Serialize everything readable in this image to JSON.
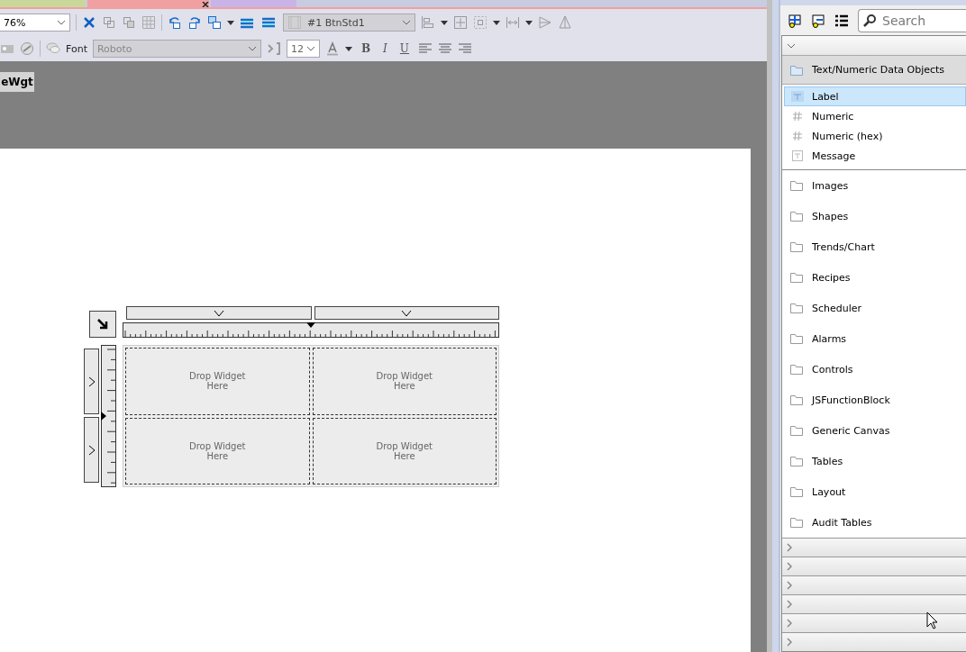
{
  "tabs": [
    {
      "color": "#c9d89a",
      "selected": false
    },
    {
      "color": "#f0a0a0",
      "selected": true
    },
    {
      "color": "#c8b4e6",
      "selected": false
    }
  ],
  "toolbar": {
    "zoom": "76%",
    "style": "#1 BtnStd1",
    "font_label": "Font",
    "font": "Roboto",
    "font_size": "12",
    "format_buttons": [
      "B",
      "I",
      "U"
    ]
  },
  "screen_tab": "eWgt",
  "widget": {
    "cells": [
      "Drop Widget\nHere",
      "Drop Widget\nHere",
      "Drop Widget\nHere",
      "Drop Widget\nHere"
    ]
  },
  "gallery": {
    "search": {
      "placeholder": "Search"
    },
    "group": {
      "title": "Text/Numeric Data Objects",
      "expanded": true,
      "items": [
        {
          "label": "Label",
          "kind": "label",
          "selected": true
        },
        {
          "label": "Numeric",
          "kind": "numeric",
          "selected": false
        },
        {
          "label": "Numeric (hex)",
          "kind": "numeric",
          "selected": false
        },
        {
          "label": "Message",
          "kind": "message",
          "selected": false
        }
      ]
    },
    "folders": [
      "Images",
      "Shapes",
      "Trends/Chart",
      "Recipes",
      "Scheduler",
      "Alarms",
      "Controls",
      "JSFunctionBlock",
      "Generic Canvas",
      "Tables",
      "Layout",
      "Audit Tables"
    ],
    "sections": [
      {
        "expanded": false
      },
      {
        "expanded": false
      },
      {
        "expanded": false
      },
      {
        "expanded": false
      },
      {
        "expanded": false
      },
      {
        "expanded": false
      }
    ]
  }
}
